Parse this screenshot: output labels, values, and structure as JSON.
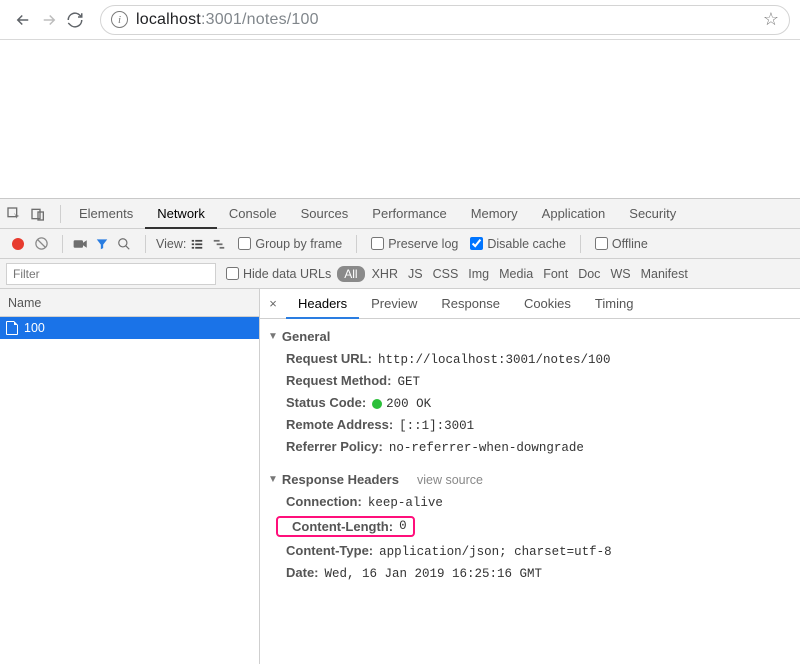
{
  "address": {
    "host": "localhost",
    "port_path": ":3001/notes/100"
  },
  "devtools_tabs": [
    "Elements",
    "Network",
    "Console",
    "Sources",
    "Performance",
    "Memory",
    "Application",
    "Security"
  ],
  "devtools_active_tab": "Network",
  "toolbar": {
    "view_label": "View:",
    "group_by_frame": "Group by frame",
    "preserve_log": "Preserve log",
    "disable_cache": "Disable cache",
    "offline": "Offline"
  },
  "filter": {
    "placeholder": "Filter",
    "hide_data_urls": "Hide data URLs",
    "types": [
      "All",
      "XHR",
      "JS",
      "CSS",
      "Img",
      "Media",
      "Font",
      "Doc",
      "WS",
      "Manifest"
    ]
  },
  "name_col_header": "Name",
  "request_name": "100",
  "detail_tabs": [
    "Headers",
    "Preview",
    "Response",
    "Cookies",
    "Timing"
  ],
  "detail_active_tab": "Headers",
  "general": {
    "title": "General",
    "request_url_label": "Request URL:",
    "request_url_value": "http://localhost:3001/notes/100",
    "request_method_label": "Request Method:",
    "request_method_value": "GET",
    "status_code_label": "Status Code:",
    "status_code_value": "200 OK",
    "remote_address_label": "Remote Address:",
    "remote_address_value": "[::1]:3001",
    "referrer_policy_label": "Referrer Policy:",
    "referrer_policy_value": "no-referrer-when-downgrade"
  },
  "response_headers": {
    "title": "Response Headers",
    "view_source": "view source",
    "connection_label": "Connection:",
    "connection_value": "keep-alive",
    "content_length_label": "Content-Length:",
    "content_length_value": "0",
    "content_type_label": "Content-Type:",
    "content_type_value": "application/json; charset=utf-8",
    "date_label": "Date:",
    "date_value": "Wed, 16 Jan 2019 16:25:16 GMT"
  }
}
